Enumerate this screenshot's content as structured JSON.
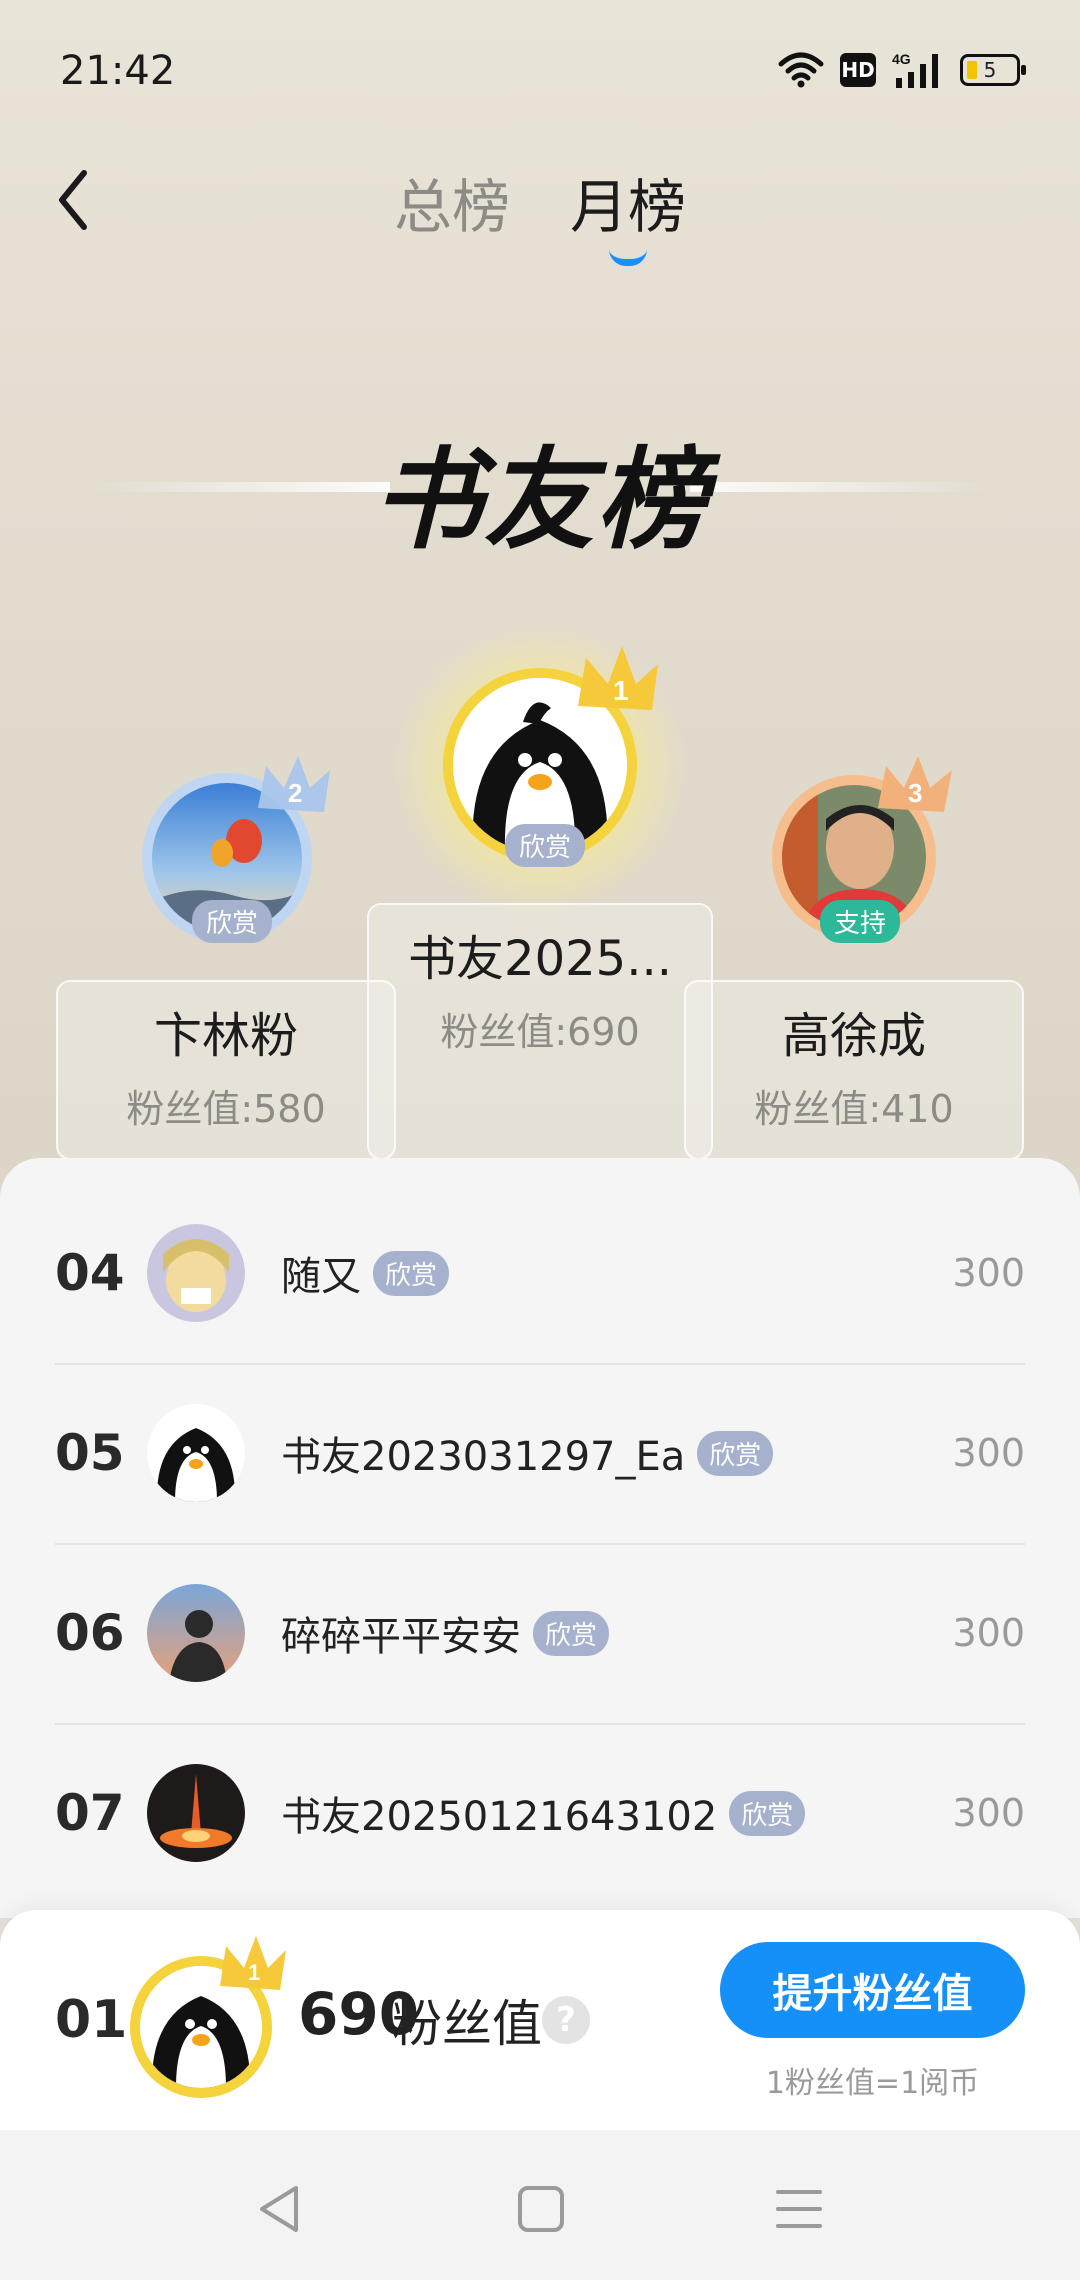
{
  "status": {
    "time": "21:42",
    "hd": "HD",
    "network": "4G",
    "battery": "5"
  },
  "tabs": [
    {
      "label": "总榜",
      "active": false
    },
    {
      "label": "月榜",
      "active": true
    }
  ],
  "banner": {
    "title": "书友榜"
  },
  "podium": {
    "first": {
      "rank": "1",
      "name": "书友2025...",
      "fans": "粉丝值:690",
      "tag": "欣赏"
    },
    "second": {
      "rank": "2",
      "name": "卞林粉",
      "fans": "粉丝值:580",
      "tag": "欣赏"
    },
    "third": {
      "rank": "3",
      "name": "高徐成",
      "fans": "粉丝值:410",
      "tag": "支持"
    }
  },
  "list": [
    {
      "rank": "04",
      "name": "随又",
      "tag": "欣赏",
      "score": "300",
      "avatar": "anime-avatar"
    },
    {
      "rank": "05",
      "name": "书友2023031297_Ea",
      "tag": "欣赏",
      "score": "300",
      "avatar": "penguin-avatar"
    },
    {
      "rank": "06",
      "name": "碎碎平平安安",
      "tag": "欣赏",
      "score": "300",
      "avatar": "silhouette-avatar"
    },
    {
      "rank": "07",
      "name": "书友20250121643102",
      "tag": "欣赏",
      "score": "300",
      "avatar": "firework-avatar"
    }
  ],
  "self": {
    "rank": "01",
    "value": "690",
    "unit": "粉丝值",
    "help": "?",
    "crown_rank": "1"
  },
  "boost": {
    "label": "提升粉丝值",
    "note": "1粉丝值=1阅币"
  },
  "colors": {
    "accent": "#1590f8",
    "gold": "#f5c93a",
    "silver": "#a9c6ea",
    "bronze": "#f2b07a",
    "tag_blue": "#a6b1cd",
    "tag_green": "#2db89a"
  }
}
